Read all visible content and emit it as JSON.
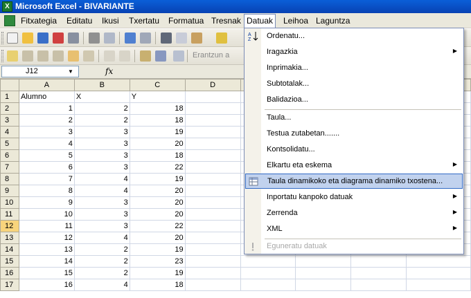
{
  "window": {
    "title": "Microsoft Excel - BIVARIANTE"
  },
  "menubar": {
    "items": [
      "Fitxategia",
      "Editatu",
      "Ikusi",
      "Txertatu",
      "Formatua",
      "Tresnak",
      "Datuak",
      "Leihoa",
      "Laguntza"
    ],
    "active": "Datuak"
  },
  "toolbar2": {
    "review_label": "Erantzun a"
  },
  "formula_bar": {
    "cell_ref": "J12",
    "fx": "fx"
  },
  "sheet": {
    "columns": [
      "A",
      "B",
      "C",
      "D"
    ],
    "active_row": 12,
    "rows": [
      {
        "n": "1",
        "a": "Alumno",
        "b": "X",
        "c": "Y"
      },
      {
        "n": "2",
        "a": "1",
        "b": "2",
        "c": "18"
      },
      {
        "n": "3",
        "a": "2",
        "b": "2",
        "c": "18"
      },
      {
        "n": "4",
        "a": "3",
        "b": "3",
        "c": "19"
      },
      {
        "n": "5",
        "a": "4",
        "b": "3",
        "c": "20"
      },
      {
        "n": "6",
        "a": "5",
        "b": "3",
        "c": "18"
      },
      {
        "n": "7",
        "a": "6",
        "b": "3",
        "c": "22"
      },
      {
        "n": "8",
        "a": "7",
        "b": "4",
        "c": "19"
      },
      {
        "n": "9",
        "a": "8",
        "b": "4",
        "c": "20"
      },
      {
        "n": "10",
        "a": "9",
        "b": "3",
        "c": "20"
      },
      {
        "n": "11",
        "a": "10",
        "b": "3",
        "c": "20"
      },
      {
        "n": "12",
        "a": "11",
        "b": "3",
        "c": "22"
      },
      {
        "n": "13",
        "a": "12",
        "b": "4",
        "c": "20"
      },
      {
        "n": "14",
        "a": "13",
        "b": "2",
        "c": "19"
      },
      {
        "n": "15",
        "a": "14",
        "b": "2",
        "c": "23"
      },
      {
        "n": "16",
        "a": "15",
        "b": "2",
        "c": "19"
      },
      {
        "n": "17",
        "a": "16",
        "b": "4",
        "c": "18"
      }
    ]
  },
  "datuak_menu": {
    "items": [
      {
        "label": "Ordenatu...",
        "icon": "sort-az-icon",
        "submenu": false
      },
      {
        "label": "Iragazkia",
        "submenu": true
      },
      {
        "label": "Inprimakia...",
        "submenu": false
      },
      {
        "label": "Subtotalak...",
        "submenu": false
      },
      {
        "label": "Balidazioa...",
        "submenu": false
      },
      {
        "label": "Taula...",
        "submenu": false
      },
      {
        "label": "Testua zutabetan.......",
        "submenu": false
      },
      {
        "label": "Kontsolidatu...",
        "submenu": false
      },
      {
        "label": "Elkartu eta eskema",
        "submenu": true
      },
      {
        "label": "Taula dinamikoko eta diagrama dinamiko txostena...",
        "icon": "pivot-table-icon",
        "submenu": false,
        "highlighted": true
      },
      {
        "label": "Inportatu kanpoko datuak",
        "submenu": true
      },
      {
        "label": "Zerrenda",
        "submenu": true
      },
      {
        "label": "XML",
        "submenu": true
      },
      {
        "label": "Eguneratu datuak",
        "icon": "refresh-data-icon",
        "submenu": false,
        "disabled": true
      }
    ]
  },
  "colors": {
    "title_bar": "#0a5fd8",
    "menu_highlight": "#c1d2ee",
    "active_header": "#f8d47c"
  }
}
